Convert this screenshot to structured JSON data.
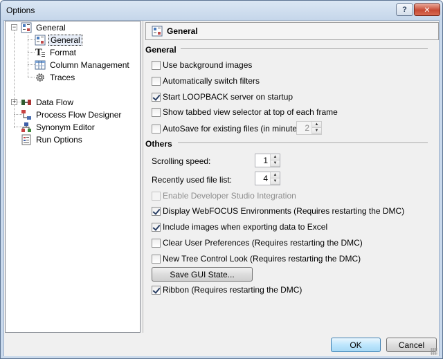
{
  "window": {
    "title": "Options"
  },
  "titlebar": {
    "help_label": "?",
    "close_label": "✕"
  },
  "tree": {
    "general": {
      "label": "General",
      "expander": "−"
    },
    "general_child": {
      "label": "General"
    },
    "format": {
      "label": "Format"
    },
    "column_management": {
      "label": "Column Management"
    },
    "traces": {
      "label": "Traces"
    },
    "data_flow": {
      "label": "Data Flow",
      "expander": "+"
    },
    "process_flow_designer": {
      "label": "Process Flow Designer"
    },
    "synonym_editor": {
      "label": "Synonym Editor"
    },
    "run_options": {
      "label": "Run Options"
    }
  },
  "panel": {
    "header": "General",
    "general_group": "General",
    "others_group": "Others",
    "options": {
      "use_background_images": {
        "label": "Use background images",
        "checked": false
      },
      "auto_switch_filters": {
        "label": "Automatically switch filters",
        "checked": false
      },
      "start_loopback": {
        "label": "Start LOOPBACK server on startup",
        "checked": true
      },
      "show_tabbed_view": {
        "label": "Show tabbed view selector at top of each frame",
        "checked": false
      },
      "autosave": {
        "label": "AutoSave for existing files (in minutes):",
        "checked": false,
        "value": "2"
      },
      "enable_dev_studio": {
        "label": "Enable Developer Studio Integration",
        "checked": false
      },
      "display_webfocus": {
        "label": "Display WebFOCUS Environments (Requires restarting the DMC)",
        "checked": true
      },
      "include_images": {
        "label": "Include images when exporting data to Excel",
        "checked": true
      },
      "clear_user_prefs": {
        "label": "Clear User Preferences (Requires restarting the DMC)",
        "checked": false
      },
      "new_tree_control": {
        "label": "New Tree Control Look (Requires restarting the DMC)",
        "checked": false
      },
      "ribbon": {
        "label": "Ribbon (Requires restarting the DMC)",
        "checked": true
      }
    },
    "scrolling_speed": {
      "label": "Scrolling speed:",
      "value": "1"
    },
    "recent_files": {
      "label": "Recently used file list:",
      "value": "4"
    },
    "save_gui_state": "Save GUI State..."
  },
  "footer": {
    "ok": "OK",
    "cancel": "Cancel"
  }
}
